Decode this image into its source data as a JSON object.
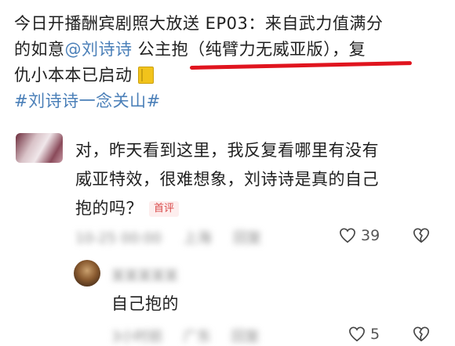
{
  "post": {
    "line1": "今日开播酬宾剧照大放送 EP03：来自武力值满分",
    "line2_prefix": "的如意",
    "mention": "@刘诗诗",
    "line2_highlight": " 公主抱（纯臂力无威亚版），复",
    "line3": "仇小本本已启动",
    "book_icon": "notebook-icon",
    "hashtag": "#刘诗诗一念关山#"
  },
  "comment": {
    "text_line1": "对，昨天看到这里，我反复看哪里有没有",
    "text_line2": "威亚特效，很难想象，刘诗诗是真的自己",
    "text_line3": "抱的吗？",
    "badge": "首评",
    "meta_time": "10-25 00:00",
    "meta_location": "上海",
    "meta_reply": "回复",
    "likes": "39"
  },
  "reply": {
    "name": "某某某某某",
    "text": "自己抱的",
    "meta_time": "3小时前",
    "meta_location": "广东",
    "meta_reply": "回复",
    "likes": "5"
  },
  "colors": {
    "link": "#4a7fb8",
    "underline": "#e0141e",
    "badge_text": "#d94a4a",
    "muted": "#9b9b9b"
  }
}
